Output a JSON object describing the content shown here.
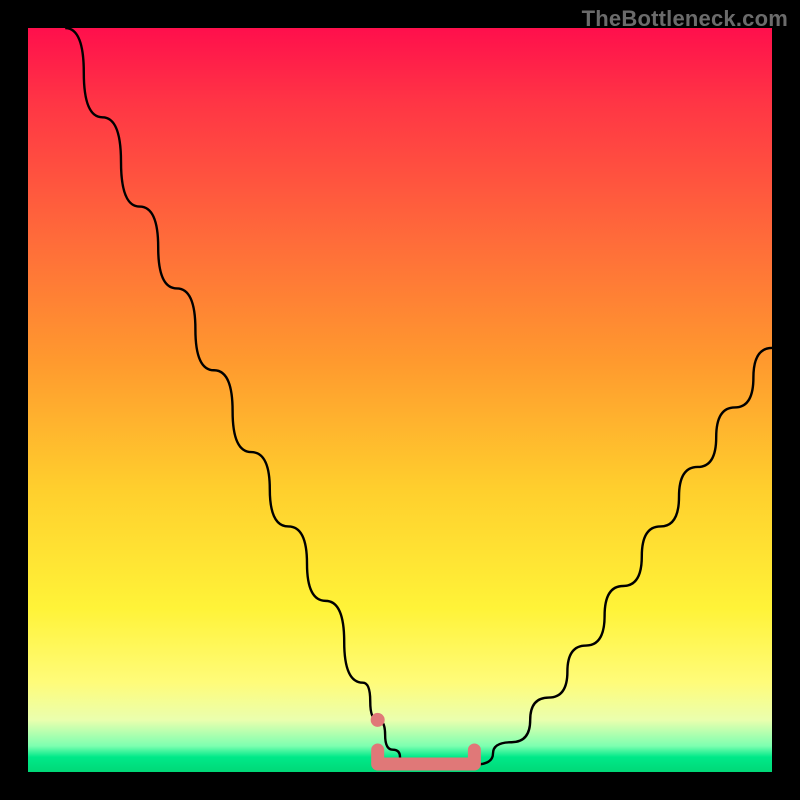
{
  "watermark": "TheBottleneck.com",
  "chart_data": {
    "type": "line",
    "title": "",
    "xlabel": "",
    "ylabel": "",
    "xlim": [
      0,
      100
    ],
    "ylim": [
      0,
      100
    ],
    "series": [
      {
        "name": "bottleneck-curve",
        "x": [
          5,
          10,
          15,
          20,
          25,
          30,
          35,
          40,
          45,
          47,
          49,
          51,
          53,
          55,
          57,
          60,
          65,
          70,
          75,
          80,
          85,
          90,
          95,
          100
        ],
        "y": [
          100,
          88,
          76,
          65,
          54,
          43,
          33,
          23,
          12,
          7,
          3,
          1,
          0.5,
          0.5,
          0.5,
          1,
          4,
          10,
          17,
          25,
          33,
          41,
          49,
          57
        ]
      }
    ],
    "marker_band": {
      "name": "optimal-range-marker",
      "color": "#e07878",
      "x_start": 47,
      "x_end": 60,
      "dot_x": 47,
      "dot_y": 7
    },
    "gradient_stops": [
      {
        "pos": 0,
        "color": "#ff0f4c"
      },
      {
        "pos": 0.45,
        "color": "#ff9a2e"
      },
      {
        "pos": 0.78,
        "color": "#fff338"
      },
      {
        "pos": 0.97,
        "color": "#00e989"
      }
    ]
  }
}
